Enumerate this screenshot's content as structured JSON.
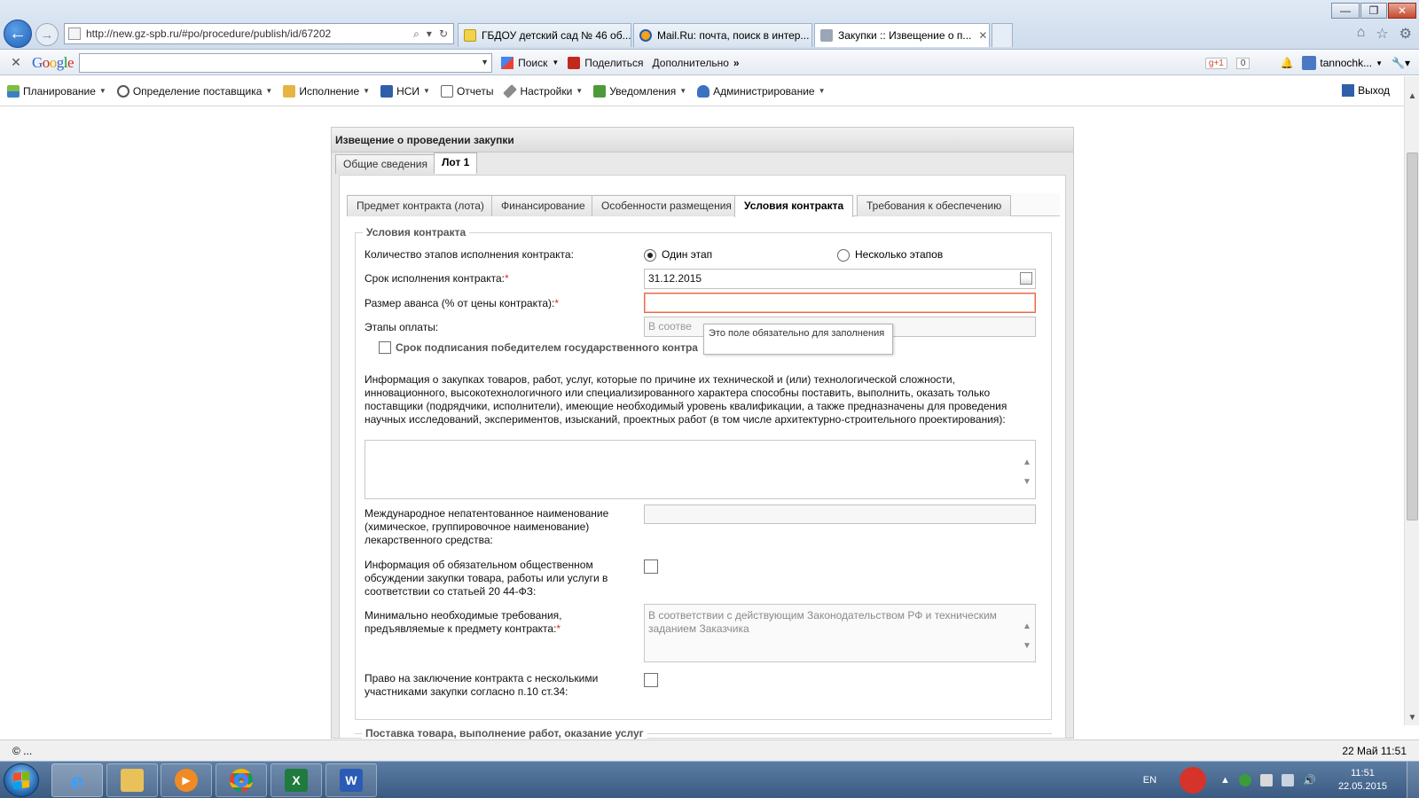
{
  "browser": {
    "url": "http://new.gz-spb.ru/#po/procedure/publish/id/67202",
    "tabs": [
      {
        "label": "ГБДОУ детский сад № 46 об..."
      },
      {
        "label": "Mail.Ru: почта, поиск в интер..."
      },
      {
        "label": "Закупки :: Извещение о п..."
      }
    ],
    "window_controls": [
      "—",
      "❐",
      "✕"
    ]
  },
  "google_toolbar": {
    "logo": "Google",
    "search_value": "",
    "search_label": "Поиск",
    "share_label": "Поделиться",
    "more_label": "Дополнительно",
    "gplus_label": "g+1",
    "gplus_count": "0",
    "user_label": "tannochk..."
  },
  "app_menu": {
    "items": [
      {
        "label": "Планирование",
        "icon": "planning-icon"
      },
      {
        "label": "Определение поставщика",
        "icon": "gears-icon"
      },
      {
        "label": "Исполнение",
        "icon": "folder-icon"
      },
      {
        "label": "НСИ",
        "icon": "book-icon"
      },
      {
        "label": "Отчеты",
        "icon": "report-icon"
      },
      {
        "label": "Настройки",
        "icon": "wrench-icon"
      },
      {
        "label": "Уведомления",
        "icon": "bell-icon"
      },
      {
        "label": "Администрирование",
        "icon": "admin-user-icon"
      }
    ],
    "exit_label": "Выход"
  },
  "panel": {
    "title": "Извещение о проведении закупки",
    "top_tabs": [
      {
        "label": "Общие сведения"
      },
      {
        "label": "Лот 1"
      }
    ],
    "sub_tabs": [
      {
        "label": "Предмет контракта (лота)"
      },
      {
        "label": "Финансирование"
      },
      {
        "label": "Особенности размещения"
      },
      {
        "label": "Условия контракта"
      },
      {
        "label": "Требования к обеспечению"
      }
    ],
    "fieldset_title": "Условия контракта",
    "fields": {
      "stages_label": "Количество этапов исполнения контракта:",
      "stage_one": "Один этап",
      "stage_many": "Несколько этапов",
      "deadline_label": "Срок исполнения контракта:",
      "deadline_value": "31.12.2015",
      "advance_label": "Размер аванса (% от цены контракта):",
      "advance_value": "",
      "payment_stages_label": "Этапы оплаты:",
      "payment_stages_value": "В соотве",
      "sign_deadline_label": "Срок подписания победителем государственного контра",
      "info_label": "Информация о закупках товаров, работ, услуг, которые по причине их технической и (или) технологической сложности, инновационного, высокотехнологичного или специализированного характера способны поставить, выполнить, оказать только поставщики (подрядчики, исполнители), имеющие необходимый уровень квалификации, а также предназначены для проведения научных исследований, экспериментов, изысканий, проектных работ (в том числе архитектурно-строительного проектирования):",
      "info_value": "",
      "inn_label": "Международное непатентованное наименование (химическое, группировочное наименование) лекарственного средства:",
      "inn_value": "",
      "public_discussion_label": "Информация об обязательном общественном обсуждении закупки товара, работы или услуги в соответствии со статьей 20 44-ФЗ:",
      "min_req_label": "Минимально необходимые требования, предъявляемые к предмету контракта:",
      "min_req_value": "В соответствии с действующим Законодательством РФ и техническим заданием Заказчика",
      "multi_participants_label": "Право на заключение контракта с несколькими участниками закупки согласно п.10 ст.34:"
    },
    "required_mark": "*",
    "tooltip": "Это поле обязательно для заполнения",
    "next_fieldset_title": "Поставка товара, выполнение работ, оказание услуг"
  },
  "statusbar": {
    "left": "© ...",
    "right": "22 Май 11:51"
  },
  "taskbar": {
    "lang": "EN",
    "time": "11:51",
    "date": "22.05.2015"
  },
  "colors": {
    "error_border": "#e86a44",
    "required": "#e02b2b",
    "taskbar": "#3a5a82"
  }
}
